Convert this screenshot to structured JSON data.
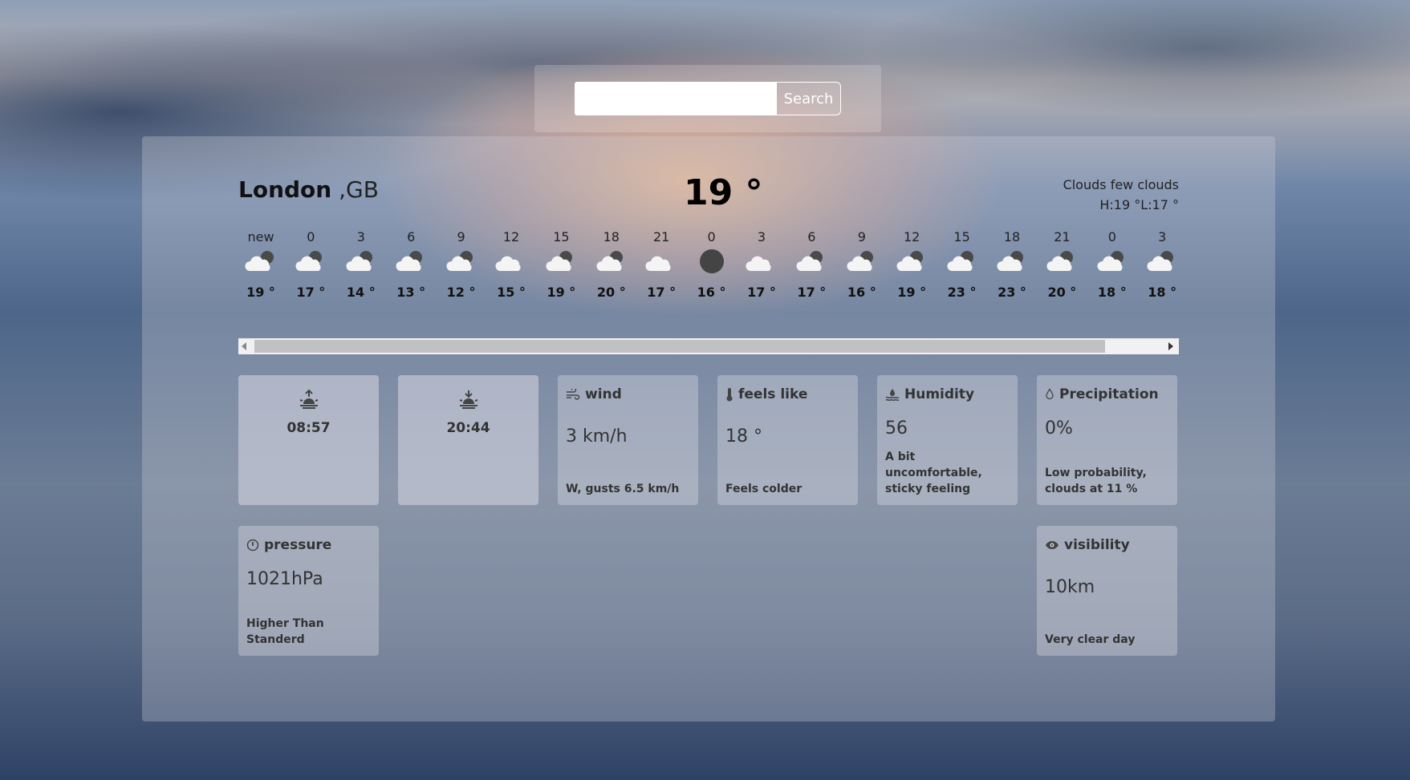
{
  "search": {
    "placeholder": "",
    "button_label": "Search"
  },
  "location": {
    "city": "London",
    "country": ",GB"
  },
  "current": {
    "temperature": "19 °",
    "description": "Clouds few clouds",
    "high_low": "H:19 °L:17 °"
  },
  "hourly": [
    {
      "time": "new",
      "icon": "night-cloud-icon",
      "temp": "19 °"
    },
    {
      "time": "0",
      "icon": "partly-cloudy-icon",
      "temp": "17 °"
    },
    {
      "time": "3",
      "icon": "partly-cloudy-icon",
      "temp": "14 °"
    },
    {
      "time": "6",
      "icon": "partly-cloudy-icon",
      "temp": "13 °"
    },
    {
      "time": "9",
      "icon": "partly-cloudy-icon",
      "temp": "12 °"
    },
    {
      "time": "12",
      "icon": "cloud-icon",
      "temp": "15 °"
    },
    {
      "time": "15",
      "icon": "partly-cloudy-icon",
      "temp": "19 °"
    },
    {
      "time": "18",
      "icon": "partly-cloudy-icon",
      "temp": "20 °"
    },
    {
      "time": "21",
      "icon": "cloud-icon",
      "temp": "17 °"
    },
    {
      "time": "0",
      "icon": "moon-icon",
      "temp": "16 °"
    },
    {
      "time": "3",
      "icon": "cloud-icon",
      "temp": "17 °"
    },
    {
      "time": "6",
      "icon": "partly-cloudy-icon",
      "temp": "17 °"
    },
    {
      "time": "9",
      "icon": "partly-cloudy-icon",
      "temp": "16 °"
    },
    {
      "time": "12",
      "icon": "partly-cloudy-icon",
      "temp": "19 °"
    },
    {
      "time": "15",
      "icon": "partly-cloudy-icon",
      "temp": "23 °"
    },
    {
      "time": "18",
      "icon": "partly-cloudy-icon",
      "temp": "23 °"
    },
    {
      "time": "21",
      "icon": "partly-cloudy-icon",
      "temp": "20 °"
    },
    {
      "time": "0",
      "icon": "partly-cloudy-icon",
      "temp": "18 °"
    },
    {
      "time": "3",
      "icon": "partly-cloudy-icon",
      "temp": "18 °"
    }
  ],
  "cards": {
    "sunrise": {
      "icon": "sunrise-icon",
      "time": "08:57"
    },
    "sunset": {
      "icon": "sunset-icon",
      "time": "20:44"
    },
    "wind": {
      "icon": "wind-icon",
      "title": "wind",
      "value": "3 km/h",
      "note": "W, gusts 6.5 km/h"
    },
    "feels_like": {
      "icon": "thermometer-icon",
      "title": "feels like",
      "value": "18 °",
      "note": "Feels colder"
    },
    "humidity": {
      "icon": "humidity-icon",
      "title": "Humidity",
      "value": "56",
      "note": "A bit uncomfortable, sticky feeling"
    },
    "precipitation": {
      "icon": "droplet-icon",
      "title": "Precipitation",
      "value": "0%",
      "note": "Low probability, clouds at 11 %"
    },
    "pressure": {
      "icon": "gauge-icon",
      "title": "pressure",
      "value": "1021hPa",
      "note": "Higher Than Standerd"
    },
    "visibility": {
      "icon": "eye-icon",
      "title": "visibility",
      "value": "10km",
      "note": "Very clear day"
    }
  }
}
